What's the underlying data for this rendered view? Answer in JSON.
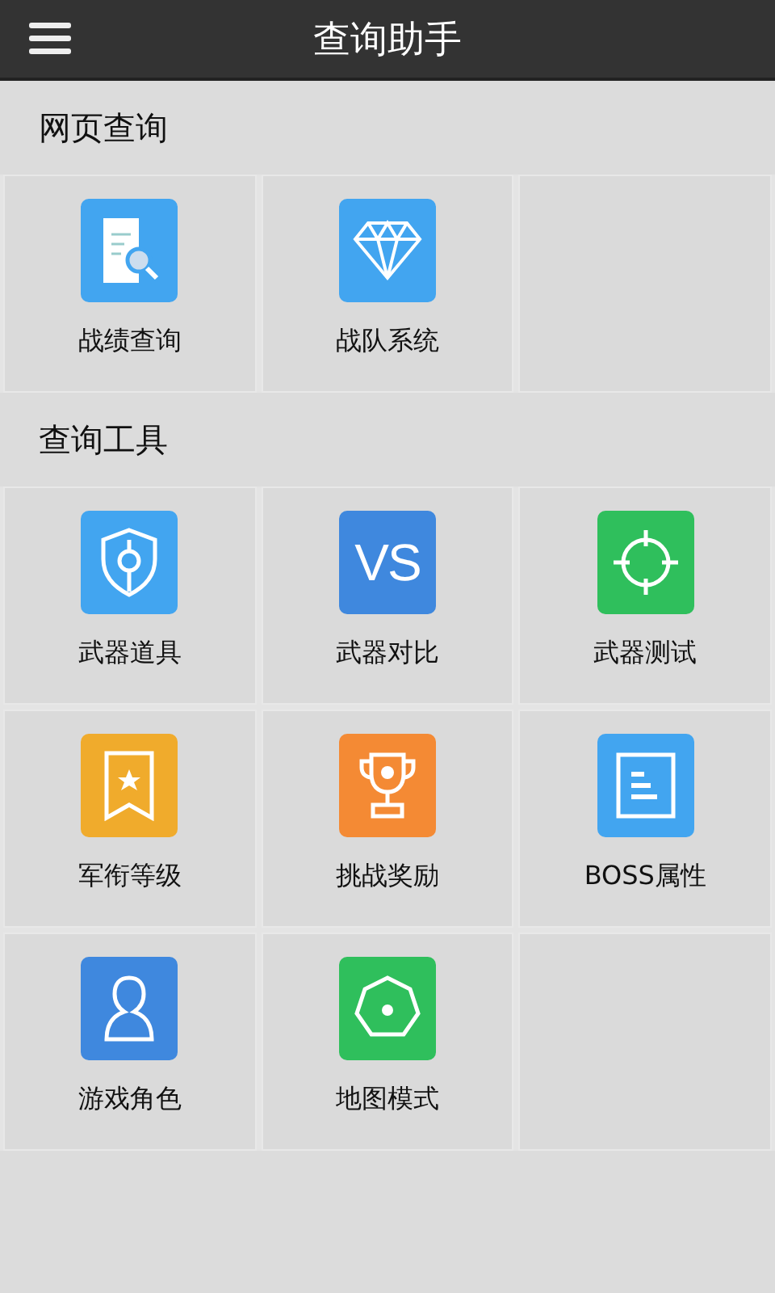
{
  "header": {
    "title": "查询助手"
  },
  "sections": [
    {
      "title": "网页查询",
      "items": [
        {
          "label": "战绩查询",
          "kind": "document-search",
          "color": "#42a5f0"
        },
        {
          "label": "战队系统",
          "kind": "diamond",
          "color": "#42a5f0"
        }
      ]
    },
    {
      "title": "查询工具",
      "items": [
        {
          "label": "武器道具",
          "kind": "shield",
          "color": "#42a5f0"
        },
        {
          "label": "武器对比",
          "kind": "text",
          "icon_text": "VS",
          "color": "#3f88de"
        },
        {
          "label": "武器测试",
          "kind": "crosshair",
          "color": "#2fbf5c"
        },
        {
          "label": "军衔等级",
          "kind": "ribbon",
          "color": "#f0ab2c"
        },
        {
          "label": "挑战奖励",
          "kind": "trophy",
          "color": "#f48a34"
        },
        {
          "label": "BOSS属性",
          "kind": "list",
          "color": "#42a5f0"
        },
        {
          "label": "游戏角色",
          "kind": "person",
          "color": "#3f88de"
        },
        {
          "label": "地图模式",
          "kind": "octagon",
          "color": "#2fbf5c"
        }
      ]
    }
  ]
}
